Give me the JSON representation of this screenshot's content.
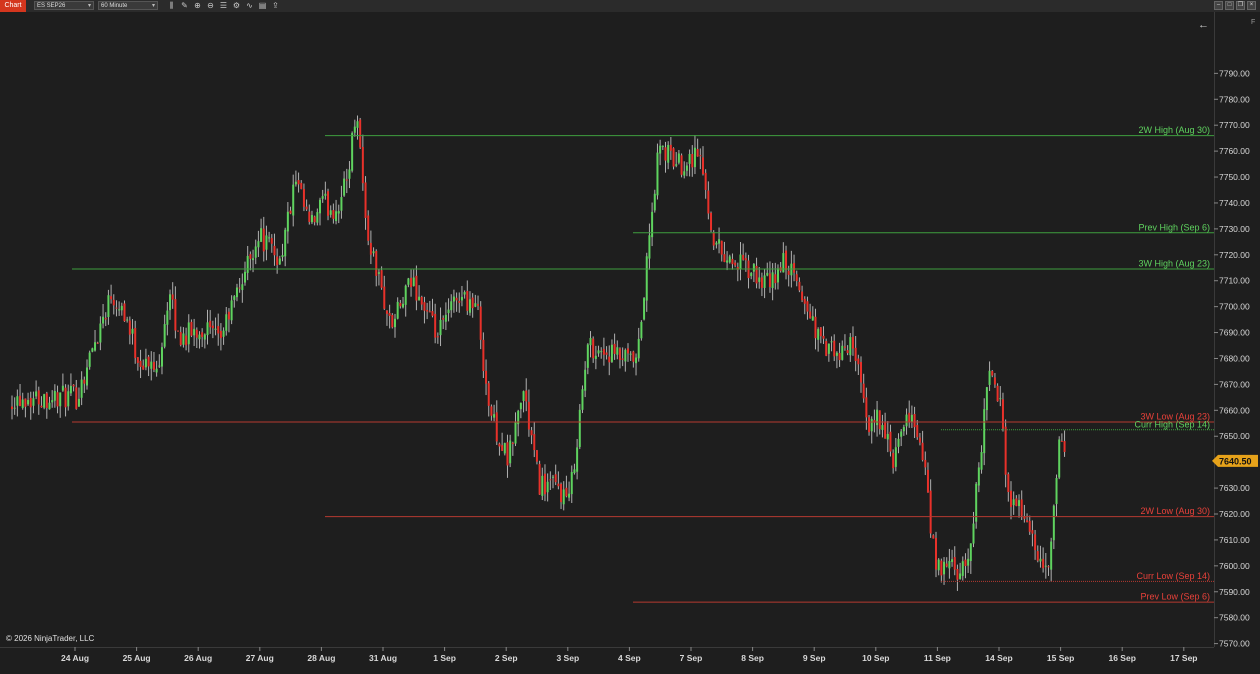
{
  "app": {
    "tab_label": "Chart",
    "instrument": "ES SEP26",
    "interval": "60 Minute",
    "copyright": "© 2026 NinjaTrader, LLC",
    "corner_glyph": "F",
    "back_arrow": "←"
  },
  "toolbar_icons": [
    "bar-type-icon",
    "draw-tools-icon",
    "zoom-in-icon",
    "zoom-out-icon",
    "properties-icon",
    "strategy-icon",
    "indicator-icon",
    "templates-icon",
    "share-icon"
  ],
  "chart_data": {
    "type": "candlestick",
    "title": "",
    "y_ticks": [
      7570,
      7580,
      7590,
      7600,
      7610,
      7620,
      7630,
      7640,
      7650,
      7660,
      7670,
      7680,
      7690,
      7700,
      7710,
      7720,
      7730,
      7740,
      7750,
      7760,
      7770,
      7780,
      7790
    ],
    "y_tick_labels": [
      "7570.00",
      "7580.00",
      "7590.00",
      "7600.00",
      "7610.00",
      "7620.00",
      "7630.00",
      "7640.00",
      "7650.00",
      "7660.00",
      "7670.00",
      "7680.00",
      "7690.00",
      "7700.00",
      "7710.00",
      "7720.00",
      "7730.00",
      "7740.00",
      "7750.00",
      "7760.00",
      "7770.00",
      "7780.00",
      "7790.00"
    ],
    "ylim": [
      7562,
      7800
    ],
    "x_labels": [
      "24 Aug",
      "25 Aug",
      "26 Aug",
      "27 Aug",
      "28 Aug",
      "31 Aug",
      "1 Sep",
      "2 Sep",
      "3 Sep",
      "4 Sep",
      "7 Sep",
      "8 Sep",
      "9 Sep",
      "10 Sep",
      "11 Sep",
      "14 Sep",
      "15 Sep",
      "16 Sep",
      "17 Sep"
    ],
    "last_price": 7640.5,
    "last_price_label": "7640.50",
    "colors": {
      "up": "#5fd35f",
      "down": "#e8312a",
      "wick": "#b0b0b0",
      "high_line": "#3f9e3f",
      "low_line": "#b63a30"
    },
    "levels": [
      {
        "label": "2W High (Aug 30)",
        "value": 7766,
        "start_day": 5,
        "kind": "high",
        "style": "solid"
      },
      {
        "label": "Prev High (Sep 6)",
        "value": 7728.5,
        "start_day": 10,
        "kind": "high",
        "style": "solid"
      },
      {
        "label": "3W High (Aug 23)",
        "value": 7714.5,
        "start_day": 0,
        "kind": "high",
        "style": "solid"
      },
      {
        "label": "3W Low (Aug 23)",
        "value": 7655.5,
        "start_day": 0,
        "kind": "low",
        "style": "solid"
      },
      {
        "label": "Curr High (Sep 14)",
        "value": 7652.5,
        "start_day": 15,
        "kind": "high",
        "style": "dotted"
      },
      {
        "label": "2W Low (Aug 30)",
        "value": 7619,
        "start_day": 5,
        "kind": "low",
        "style": "solid"
      },
      {
        "label": "Curr Low (Sep 14)",
        "value": 7594,
        "start_day": 15,
        "kind": "low",
        "style": "dotted"
      },
      {
        "label": "Prev Low (Sep 6)",
        "value": 7586,
        "start_day": 10,
        "kind": "low",
        "style": "solid"
      }
    ],
    "path_anchors": [
      {
        "t": 0.0,
        "p": 7665
      },
      {
        "t": 0.55,
        "p": 7705
      },
      {
        "t": 0.75,
        "p": 7700
      },
      {
        "t": 1.0,
        "p": 7680
      },
      {
        "t": 1.3,
        "p": 7675
      },
      {
        "t": 1.5,
        "p": 7705
      },
      {
        "t": 1.65,
        "p": 7688
      },
      {
        "t": 2.1,
        "p": 7692
      },
      {
        "t": 2.3,
        "p": 7686
      },
      {
        "t": 2.6,
        "p": 7705
      },
      {
        "t": 2.95,
        "p": 7728
      },
      {
        "t": 3.3,
        "p": 7718
      },
      {
        "t": 3.55,
        "p": 7748
      },
      {
        "t": 3.8,
        "p": 7730
      },
      {
        "t": 3.98,
        "p": 7740
      },
      {
        "t": 4.2,
        "p": 7737
      },
      {
        "t": 4.38,
        "p": 7748
      },
      {
        "t": 4.55,
        "p": 7778
      },
      {
        "t": 4.7,
        "p": 7730
      },
      {
        "t": 5.1,
        "p": 7692
      },
      {
        "t": 5.45,
        "p": 7710
      },
      {
        "t": 5.85,
        "p": 7688
      },
      {
        "t": 6.2,
        "p": 7705
      },
      {
        "t": 6.5,
        "p": 7700
      },
      {
        "t": 6.7,
        "p": 7660
      },
      {
        "t": 7.0,
        "p": 7640
      },
      {
        "t": 7.25,
        "p": 7668
      },
      {
        "t": 7.5,
        "p": 7632
      },
      {
        "t": 7.8,
        "p": 7630
      },
      {
        "t": 8.0,
        "p": 7625
      },
      {
        "t": 8.3,
        "p": 7685
      },
      {
        "t": 8.8,
        "p": 7680
      },
      {
        "t": 9.1,
        "p": 7678
      },
      {
        "t": 9.25,
        "p": 7715
      },
      {
        "t": 9.45,
        "p": 7761
      },
      {
        "t": 9.8,
        "p": 7755
      },
      {
        "t": 10.1,
        "p": 7760
      },
      {
        "t": 10.35,
        "p": 7725
      },
      {
        "t": 10.6,
        "p": 7718
      },
      {
        "t": 10.85,
        "p": 7715
      },
      {
        "t": 11.0,
        "p": 7712
      },
      {
        "t": 11.25,
        "p": 7708
      },
      {
        "t": 11.5,
        "p": 7718
      },
      {
        "t": 11.85,
        "p": 7700
      },
      {
        "t": 12.1,
        "p": 7685
      },
      {
        "t": 12.4,
        "p": 7680
      },
      {
        "t": 12.6,
        "p": 7688
      },
      {
        "t": 12.85,
        "p": 7650
      },
      {
        "t": 13.0,
        "p": 7660
      },
      {
        "t": 13.25,
        "p": 7640
      },
      {
        "t": 13.55,
        "p": 7660
      },
      {
        "t": 13.75,
        "p": 7640
      },
      {
        "t": 13.95,
        "p": 7598
      },
      {
        "t": 14.2,
        "p": 7600
      },
      {
        "t": 14.35,
        "p": 7595
      },
      {
        "t": 14.5,
        "p": 7605
      },
      {
        "t": 14.65,
        "p": 7640
      },
      {
        "t": 14.85,
        "p": 7680
      },
      {
        "t": 14.92,
        "p": 7665
      },
      {
        "t": 14.99,
        "p": 7662
      },
      {
        "t": 15.12,
        "p": 7628
      },
      {
        "t": 15.4,
        "p": 7620
      },
      {
        "t": 15.6,
        "p": 7600
      },
      {
        "t": 15.8,
        "p": 7600
      },
      {
        "t": 15.95,
        "p": 7647
      },
      {
        "t": 16.05,
        "p": 7640.5
      }
    ]
  }
}
